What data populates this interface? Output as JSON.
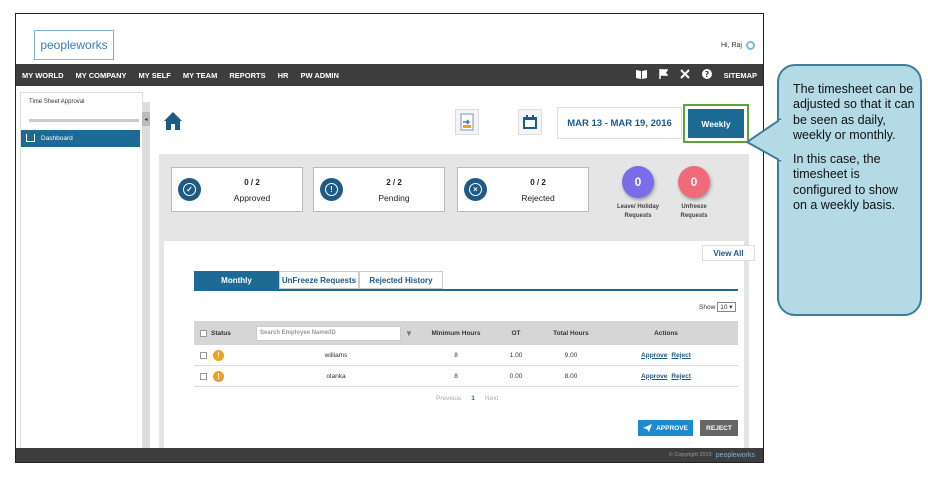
{
  "header": {
    "logo_text": "peopleworks",
    "greeting": "Hi, Raj"
  },
  "nav": {
    "items": [
      "MY WORLD",
      "MY COMPANY",
      "MY SELF",
      "MY TEAM",
      "REPORTS",
      "HR",
      "PW ADMIN"
    ],
    "sitemap": "SITEMAP"
  },
  "sidebar": {
    "title": "Time Sheet Approval",
    "dashboard": "Dashboard"
  },
  "toolbar": {
    "date_range": "MAR 13 - MAR 19, 2016",
    "weekly": "Weekly"
  },
  "stats": [
    {
      "value": "0 / 2",
      "label": "Approved"
    },
    {
      "value": "2 / 2",
      "label": "Pending"
    },
    {
      "value": "0 / 2",
      "label": "Rejected"
    }
  ],
  "bubbles": [
    {
      "value": "0",
      "line1": "Leave/ Holiday",
      "line2": "Requests",
      "color": "#7a6ee8"
    },
    {
      "value": "0",
      "line1": "Unfreeze",
      "line2": "Requests",
      "color": "#f06a7a"
    }
  ],
  "view_all": "View All",
  "tabs": [
    "Monthly",
    "UnFreeze Requests",
    "Rejected History"
  ],
  "show": {
    "label": "Show",
    "value": "10 ▾"
  },
  "table": {
    "headers": {
      "status": "Status",
      "search_placeholder": "Search Employee Name/ID",
      "min_hours": "Minimum Hours",
      "ot": "OT",
      "total": "Total Hours",
      "actions": "Actions"
    },
    "rows": [
      {
        "name": "williams",
        "min": "8",
        "ot": "1.00",
        "total": "9.00",
        "approve": "Approve",
        "reject": "Reject"
      },
      {
        "name": "olanka",
        "min": "8",
        "ot": "0.00",
        "total": "8.00",
        "approve": "Approve",
        "reject": "Reject"
      }
    ]
  },
  "pager": {
    "prev": "Previous",
    "page": "1",
    "next": "Next"
  },
  "actions": {
    "approve": "APPROVE",
    "reject": "REJECT"
  },
  "footer": {
    "copyright": "© Copyright 2016",
    "logo": "peopleworks"
  },
  "callout": {
    "p1": "The timesheet can be adjusted so that it can be seen as daily, weekly or monthly.",
    "p2": "In this case, the timesheet is configured to show on a weekly basis."
  }
}
